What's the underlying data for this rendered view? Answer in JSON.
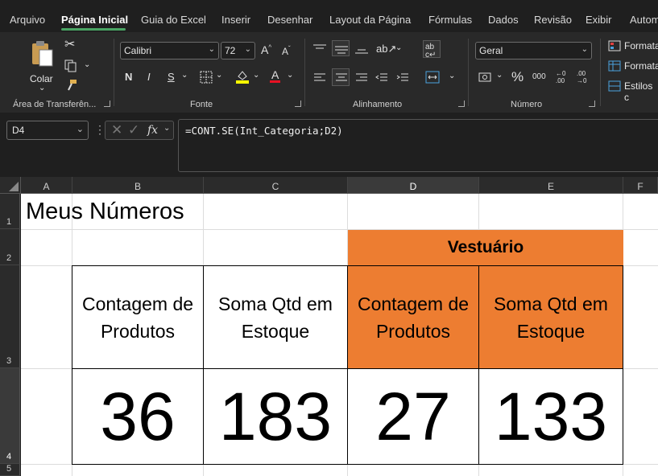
{
  "menu": {
    "tabs": [
      "Arquivo",
      "Página Inicial",
      "Guia do Excel",
      "Inserir",
      "Desenhar",
      "Layout da Página",
      "Fórmulas",
      "Dados",
      "Revisão",
      "Exibir",
      "Autom"
    ]
  },
  "ribbon": {
    "clipboard": {
      "paste_label": "Colar",
      "group_label": "Área de Transferên..."
    },
    "font": {
      "name": "Calibri",
      "size": "72",
      "bold": "N",
      "italic": "I",
      "underline": "S",
      "group_label": "Fonte",
      "font_color": "#e81123",
      "fill_color": "#ffff00"
    },
    "alignment": {
      "group_label": "Alinhamento"
    },
    "number": {
      "format": "Geral",
      "group_label": "Número"
    },
    "styles": {
      "item1": "Formata",
      "item2": "Formata",
      "item3": "Estilos c"
    }
  },
  "formula_bar": {
    "name_box": "D4",
    "fx": "fx",
    "formula": "=CONT.SE(Int_Categoria;D2)"
  },
  "grid": {
    "columns": [
      "A",
      "B",
      "C",
      "D",
      "E",
      "F"
    ],
    "rows": [
      "1",
      "2",
      "3",
      "4",
      "5"
    ],
    "cells": {
      "A1": "Meus Números",
      "D2": "Vestuário",
      "B3": "Contagem de Produtos",
      "C3": "Soma Qtd em Estoque",
      "D3": "Contagem de Produtos",
      "E3": "Soma Qtd em Estoque",
      "B4": "36",
      "C4": "183",
      "D4": "27",
      "E4": "133"
    },
    "accent_color": "#ed7d31"
  }
}
